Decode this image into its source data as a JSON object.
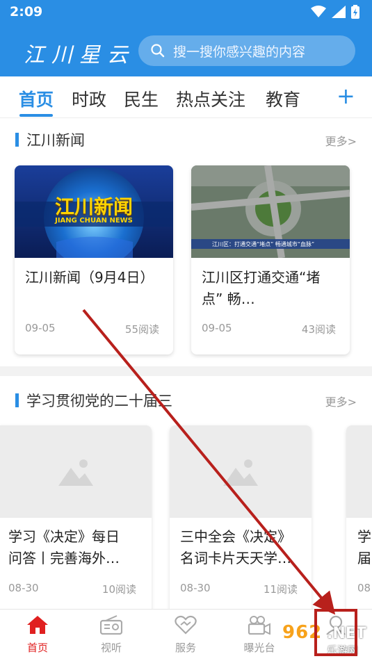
{
  "status_bar": {
    "time": "2:09"
  },
  "header": {
    "logo": "江川星云",
    "search_placeholder": "搜一搜你感兴趣的内容"
  },
  "tabs": [
    {
      "label": "首页",
      "active": true
    },
    {
      "label": "时政"
    },
    {
      "label": "民生"
    },
    {
      "label": "热点关注"
    },
    {
      "label": "教育"
    }
  ],
  "sections": [
    {
      "title": "江川新闻",
      "more": "更多>",
      "cards": [
        {
          "title": "江川新闻（9月4日）",
          "date": "09-05",
          "reads": "55阅读",
          "banner_cn": "江川新闻",
          "banner_en": "JIANG CHUAN NEWS"
        },
        {
          "title": "江川区打通交通“堵点” 畅…",
          "date": "09-05",
          "reads": "43阅读",
          "caption": "江川区：打通交通“堵点” 畅通城市“血脉”"
        }
      ]
    },
    {
      "title": "学习贯彻党的二十届三",
      "more": "更多>",
      "cards": [
        {
          "title_line1": "学习《决定》每日",
          "title_line2": "问答丨完善海外…",
          "date": "08-30",
          "reads": "10阅读"
        },
        {
          "title_line1": "三中全会《决定》",
          "title_line2": "名词卡片天天学…",
          "date": "08-30",
          "reads": "11阅读"
        },
        {
          "title_line1": "学",
          "title_line2": "届",
          "date": "08"
        }
      ]
    }
  ],
  "bottom_nav": [
    {
      "label": "首页",
      "icon": "home-icon",
      "active": true
    },
    {
      "label": "视听",
      "icon": "radio-icon"
    },
    {
      "label": "服务",
      "icon": "service-icon"
    },
    {
      "label": "曝光台",
      "icon": "camera-icon"
    },
    {
      "label": "",
      "icon": "user-icon"
    }
  ],
  "watermark": {
    "num": "962",
    "net": ".NET",
    "sub": "乐游网"
  },
  "colors": {
    "primary": "#2a8ee4",
    "active_nav": "#e02020",
    "annotation": "#b8201c"
  }
}
